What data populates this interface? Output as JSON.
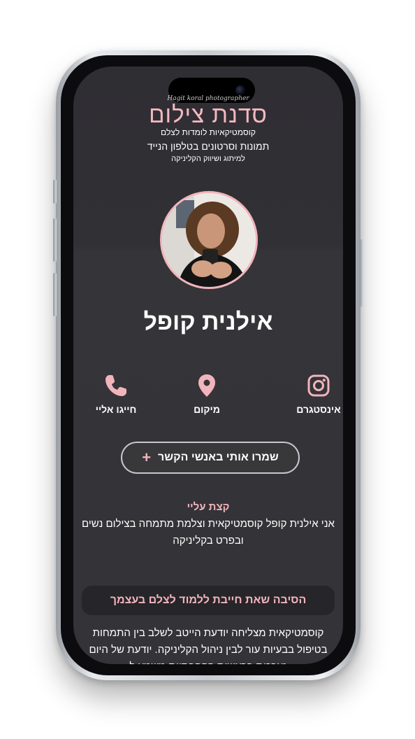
{
  "brand": {
    "tagline": "Hagit koral photographer",
    "title": "סדנת צילום",
    "subtitle1": "קוסמטיקאיות לומדות לצלם",
    "subtitle2": "תמונות וסרטונים בטלפון הנייד",
    "subtitle3": "למיתוג ושיווק הקליניקה"
  },
  "profile": {
    "name": "אילנית קופל"
  },
  "actions": [
    {
      "label": "אינסטגרם",
      "icon": "instagram-icon"
    },
    {
      "label": "מיקום",
      "icon": "location-pin-icon"
    },
    {
      "label": "חייגו אליי",
      "icon": "phone-icon"
    }
  ],
  "save_contact": {
    "label": "שמרו אותי באנשי הקשר",
    "icon": "plus-icon"
  },
  "about": {
    "title": "קצת עליי",
    "text": "אני אילנית קופל קוסמטיקאית וצלמת מתמחה בצילום נשים ובפרט בקליניקה"
  },
  "reason": {
    "title": "הסיבה שאת חייבת ללמוד לצלם בעצמך",
    "text": "קוסמטיקאית מצליחה יודעת הייטב לשלב בין התמחות בטיפול בבעיות עור לבין ניהול הקליניקה. יודעת של היום נערכות בראשות הקהבתיות משמע ל"
  },
  "colors": {
    "accent": "#f2b4bc",
    "screen_bg": "#333237",
    "text": "#ffffff"
  }
}
